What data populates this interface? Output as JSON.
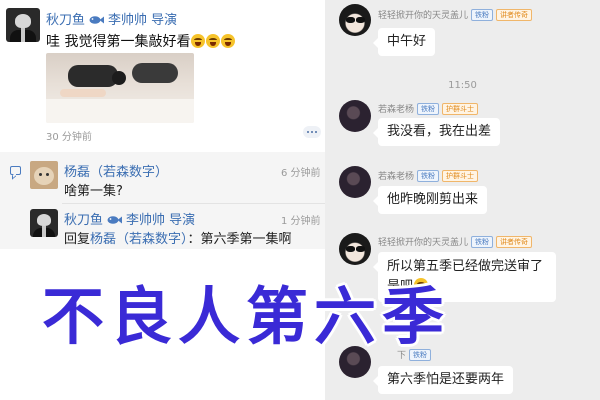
{
  "comment_post": {
    "author": "秋刀鱼",
    "badge_icon": "fish-icon",
    "author_tags": "李帅帅 导演",
    "text": "哇 我觉得第一集敲好看",
    "emoji_icon": "laughing-tears-emoji",
    "time": "30 分钟前"
  },
  "replies": [
    {
      "author": "杨磊（若森数字）",
      "time": "6 分钟前",
      "text": "啥第一集?"
    },
    {
      "author": "秋刀鱼",
      "author_tags": "李帅帅 导演",
      "time": "1 分钟前",
      "reply_prefix": "回复",
      "mention": "杨磊（若森数字）",
      "reply_body": "：第六季第一集啊"
    }
  ],
  "chat": {
    "time_divider": "11:50",
    "messages": [
      {
        "sender": "轻轻掀开你的天灵盖儿",
        "badges": [
          "铁粉",
          "讲者传奇"
        ],
        "badge_colors": [
          "blue",
          "orange"
        ],
        "text": "中午好"
      },
      {
        "sender": "若森老杨",
        "badges": [
          "铁粉",
          "护群斗士"
        ],
        "badge_colors": [
          "blue",
          "orange"
        ],
        "text": "我没看，我在出差"
      },
      {
        "sender": "若森老杨",
        "badges": [
          "铁粉",
          "护群斗士"
        ],
        "badge_colors": [
          "blue",
          "orange"
        ],
        "text": "他昨晚刚剪出来"
      },
      {
        "sender": "轻轻掀开你的天灵盖儿",
        "badges": [
          "铁粉",
          "讲者传奇"
        ],
        "badge_colors": [
          "blue",
          "orange"
        ],
        "text": "所以第五季已经做完送审了是吧",
        "emoji_icon": "laughing-emoji"
      },
      {
        "sender": "下",
        "badges": [
          "铁粉"
        ],
        "badge_colors": [
          "blue"
        ],
        "text": "第六季怕是还要两年"
      }
    ]
  },
  "overlay_title": "不良人第六季",
  "colors": {
    "link_blue": "#3b6eb2",
    "overlay_text": "#3a2ad6",
    "chat_bg": "#ededed",
    "badge_blue": "#4a7bc0",
    "badge_orange": "#e08a1c"
  }
}
